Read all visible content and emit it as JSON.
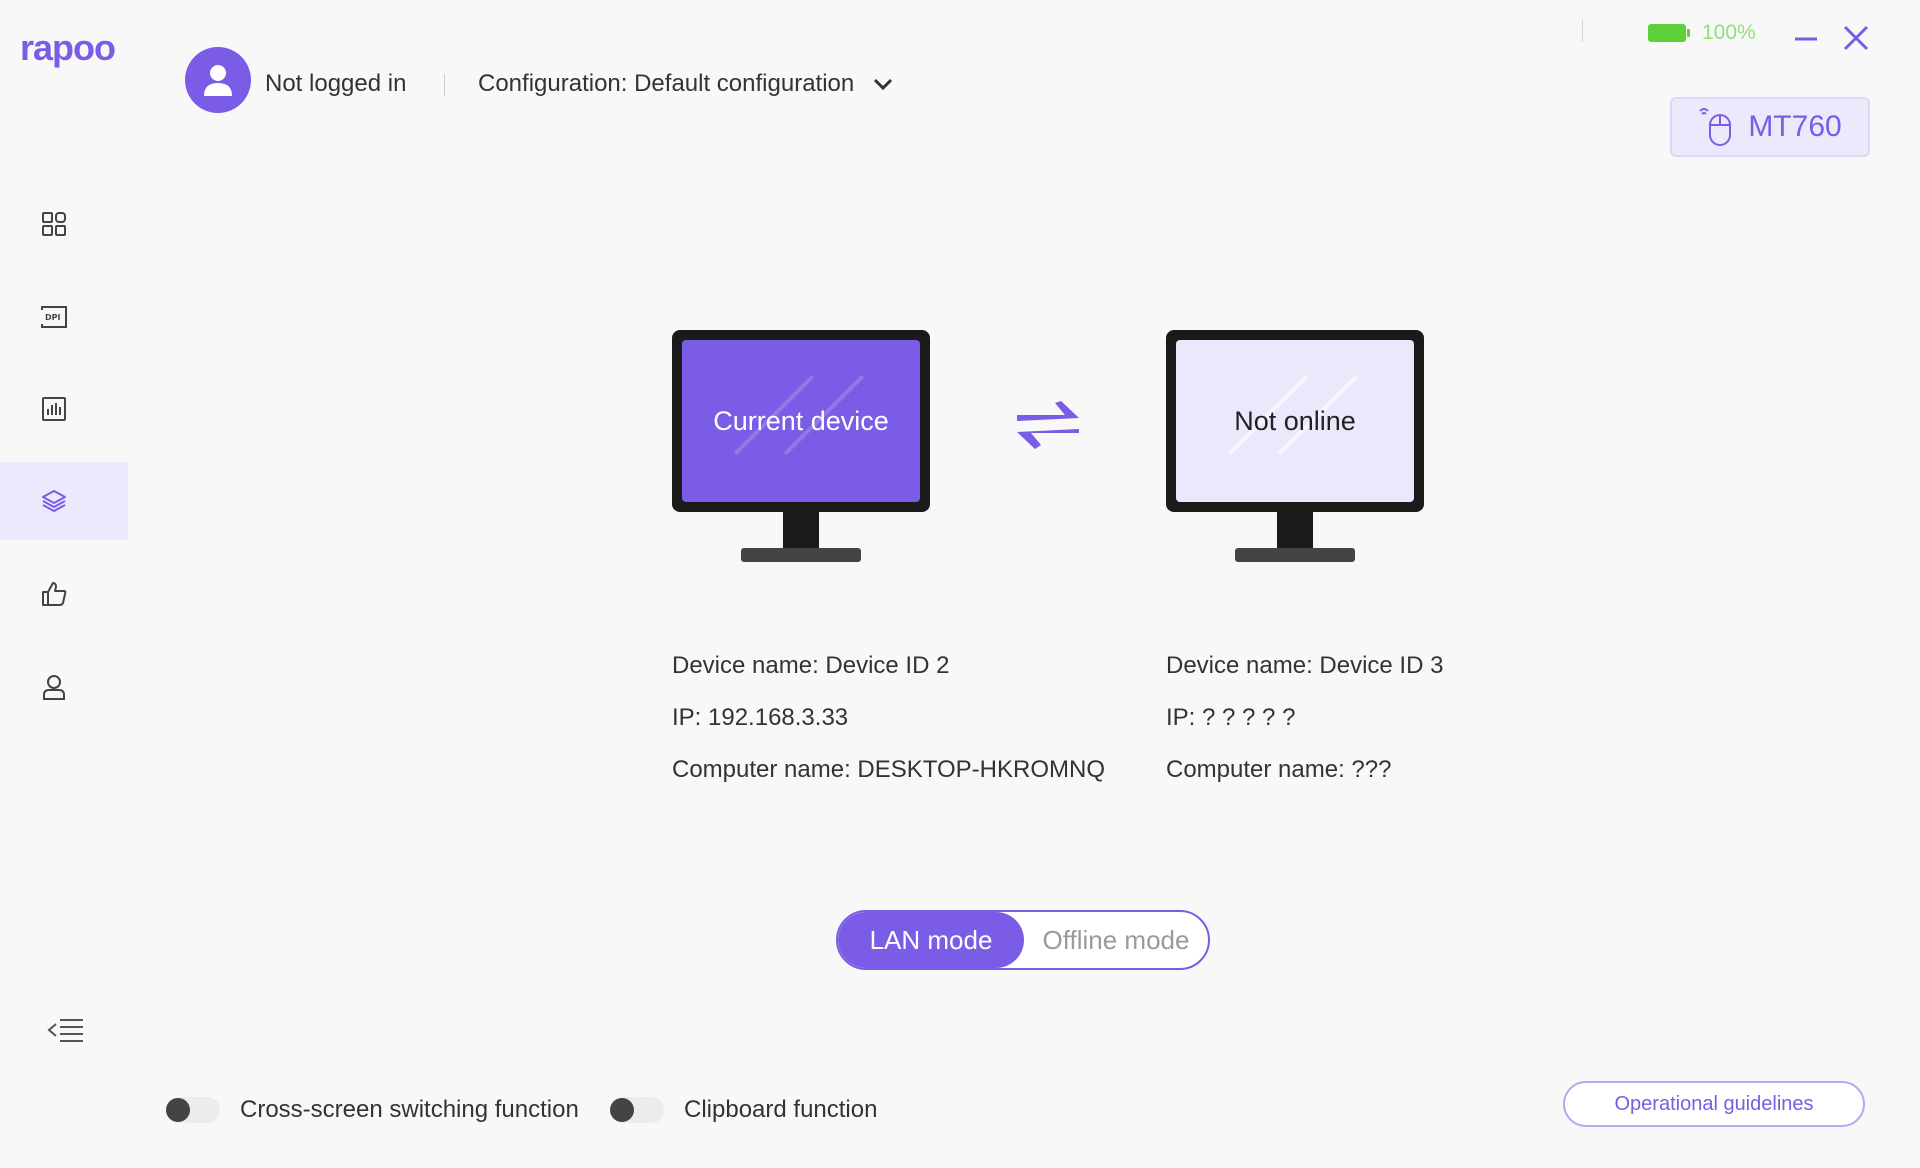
{
  "brand": {
    "logo_text": "rapoo",
    "accent": "#7a5ce6"
  },
  "header": {
    "login_status": "Not logged in",
    "configuration_label": "Configuration: Default configuration"
  },
  "status": {
    "battery_percent": "100%",
    "battery_color": "#5ed13a"
  },
  "device": {
    "model": "MT760"
  },
  "sidebar": {
    "items": [
      {
        "icon": "grid-icon"
      },
      {
        "icon": "dpi-icon"
      },
      {
        "icon": "bar-chart-icon"
      },
      {
        "icon": "layers-icon",
        "active": true
      },
      {
        "icon": "thumbs-up-icon"
      },
      {
        "icon": "user-icon"
      }
    ]
  },
  "main": {
    "current_device": {
      "screen_label": "Current device",
      "device_name": "Device name: Device ID 2",
      "ip": "IP: 192.168.3.33",
      "computer_name": "Computer name: DESKTOP-HKROMNQ"
    },
    "remote_device": {
      "screen_label": "Not online",
      "device_name": "Device name: Device ID 3",
      "ip": "IP: ? ? ? ? ?",
      "computer_name": "Computer name: ???"
    },
    "modes": {
      "active": "LAN mode",
      "inactive": "Offline mode"
    }
  },
  "footer": {
    "cross_screen_label": "Cross-screen switching function",
    "clipboard_label": "Clipboard function",
    "guidelines_button": "Operational guidelines"
  }
}
